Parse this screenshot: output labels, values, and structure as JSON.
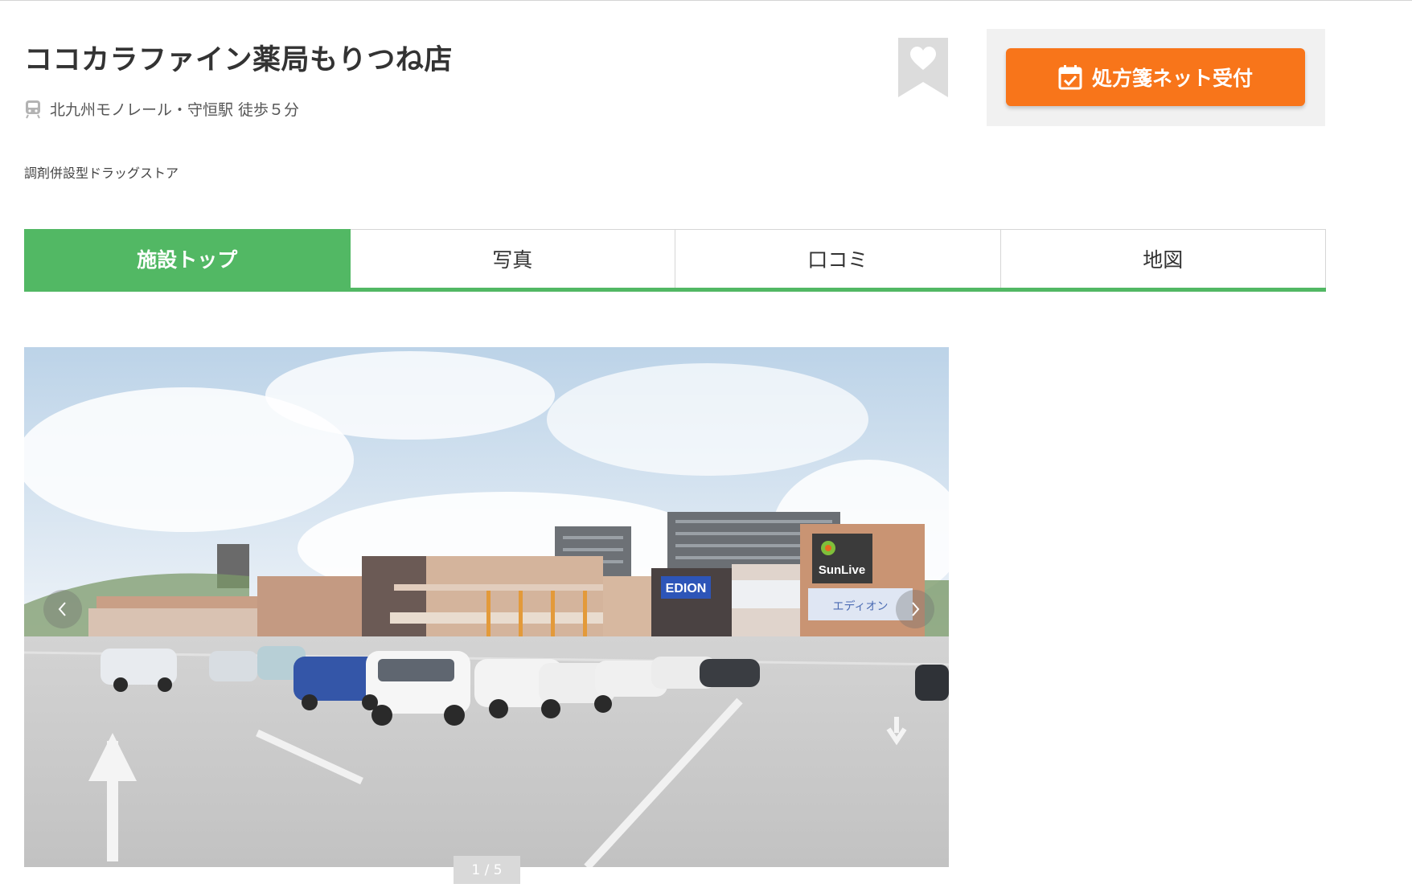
{
  "store": {
    "name": "ココカラファイン薬局もりつね店",
    "access": "北九州モノレール・守恒駅 徒歩５分",
    "category": "調剤併設型ドラッグストア"
  },
  "actions": {
    "prescription_button": "処方箋ネット受付"
  },
  "tabs": [
    {
      "label": "施設トップ",
      "active": true
    },
    {
      "label": "写真",
      "active": false
    },
    {
      "label": "口コミ",
      "active": false
    },
    {
      "label": "地図",
      "active": false
    }
  ],
  "gallery": {
    "counter": "1 / 5",
    "photo_signs": {
      "store_sign": "SunLive",
      "electronics_sign": "EDION",
      "banner_text": "エディオン"
    }
  },
  "icons": {
    "access": "train-icon",
    "bookmark": "heart-icon",
    "prescription": "calendar-check-icon",
    "prev": "chevron-left-icon",
    "next": "chevron-right-icon"
  },
  "colors": {
    "accent_green": "#52b864",
    "button_orange": "#f8751a",
    "bookmark_gray": "#dcdcdc"
  }
}
